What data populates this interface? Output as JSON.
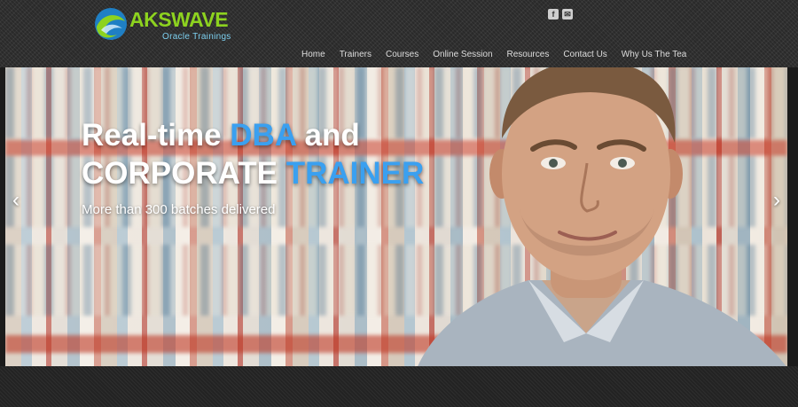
{
  "brand": {
    "name": "AKSWAVE",
    "tagline": "Oracle Trainings"
  },
  "social": [
    {
      "icon": "facebook-icon",
      "glyph": "f"
    },
    {
      "icon": "email-icon",
      "glyph": "✉"
    }
  ],
  "nav": {
    "items": [
      "Home",
      "Trainers",
      "Courses",
      "Online Session",
      "Resources",
      "Contact Us",
      "Why Us The Tea"
    ]
  },
  "hero": {
    "headline_part1": "Real-time ",
    "headline_highlight1": "DBA",
    "headline_part2": " and",
    "headline_part3": "CORPORATE ",
    "headline_highlight2": "TRAINER",
    "subtitle": "More than 300 batches delivered",
    "prev_glyph": "‹",
    "next_glyph": "›"
  },
  "colors": {
    "accent": "#3aa0f0",
    "logo_green": "#8dd21f",
    "tagline_blue": "#7ccfef"
  }
}
